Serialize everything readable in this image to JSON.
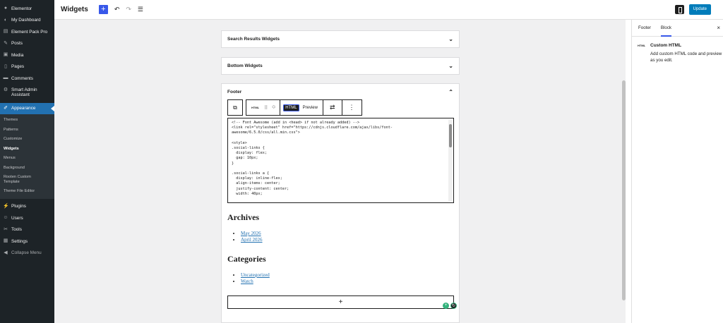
{
  "sidebar": {
    "items": [
      {
        "label": "Elementor",
        "icon": "elementor-icon"
      },
      {
        "label": "My Dashboard",
        "icon": "dashboard-icon"
      },
      {
        "label": "Element Pack Pro",
        "icon": "element-pack-icon"
      },
      {
        "label": "Posts",
        "icon": "pin-icon"
      },
      {
        "label": "Media",
        "icon": "media-icon"
      },
      {
        "label": "Pages",
        "icon": "page-icon"
      },
      {
        "label": "Comments",
        "icon": "comment-icon"
      },
      {
        "label": "Smart Admin Assistant",
        "icon": "assistant-icon"
      },
      {
        "label": "Appearance",
        "icon": "brush-icon"
      }
    ],
    "submenu": [
      "Themes",
      "Patterns",
      "Customize",
      "Widgets",
      "Menus",
      "Background",
      "Rooten Custom Template",
      "Theme File Editor"
    ],
    "bottom_items": [
      {
        "label": "Plugins",
        "icon": "plug-icon"
      },
      {
        "label": "Users",
        "icon": "users-icon"
      },
      {
        "label": "Tools",
        "icon": "wrench-icon"
      },
      {
        "label": "Settings",
        "icon": "settings-icon"
      },
      {
        "label": "Collapse Menu",
        "icon": "collapse-icon"
      }
    ]
  },
  "header": {
    "title": "Widgets",
    "add": "+",
    "undo": "↶",
    "redo": "↷",
    "list_view": "☰",
    "update_label": "Update"
  },
  "canvas": {
    "areas": [
      {
        "title": "Search Results Widgets"
      },
      {
        "title": "Bottom Widgets"
      },
      {
        "title": "Footer"
      }
    ],
    "toolbar": {
      "html_icon": "HTML",
      "tab_html": "HTML",
      "tab_preview": "Preview"
    },
    "code": "<!-- Font Awesome (add in <head> if not already added) -->\n<link rel=\"stylesheet\" href=\"https://cdnjs.cloudflare.com/ajax/libs/font-\nawesome/6.5.0/css/all.min.css\">\n\n<style>\n.social-links {\n  display: flex;\n  gap: 10px;\n}\n\n.social-links a {\n  display: inline-flex;\n  align-items: center;\n  justify-content: center;\n  width: 40px;",
    "archives_title": "Archives",
    "archives": [
      "May 2026",
      "April 2026"
    ],
    "categories_title": "Categories",
    "categories": [
      "Uncategorized",
      "Watch"
    ],
    "add_block": "+"
  },
  "settings": {
    "tabs": [
      "Footer",
      "Block"
    ],
    "active_tab": "Block",
    "close": "×",
    "block_icon": "HTML",
    "block_name": "Custom HTML",
    "block_desc": "Add custom HTML code and preview it as you edit."
  },
  "colors": {
    "admin_bg": "#1d2327",
    "accent": "#2271b1",
    "wp_blue": "#3858e9",
    "update_btn": "#007cba",
    "canvas_bg": "#f0f0f1"
  }
}
